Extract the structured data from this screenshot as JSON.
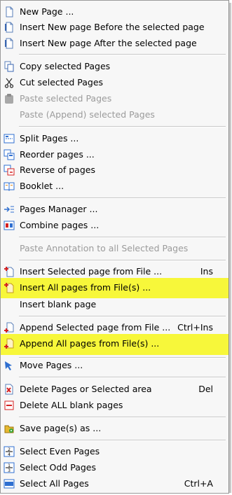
{
  "menu": {
    "items": [
      {
        "label": "New Page ...",
        "shortcut": "",
        "icon": "new-page-icon",
        "disabled": false,
        "highlighted": false
      },
      {
        "label": "Insert New page Before the selected page",
        "shortcut": "",
        "icon": "page-icon",
        "disabled": false,
        "highlighted": false
      },
      {
        "label": "Insert New page After the selected page",
        "shortcut": "",
        "icon": "page-icon",
        "disabled": false,
        "highlighted": false
      },
      {
        "label": "Copy selected Pages",
        "shortcut": "",
        "icon": "copy-icon",
        "disabled": false,
        "highlighted": false
      },
      {
        "label": "Cut selected Pages",
        "shortcut": "",
        "icon": "scissors-icon",
        "disabled": false,
        "highlighted": false
      },
      {
        "label": "Paste selected Pages",
        "shortcut": "",
        "icon": "paste-icon",
        "disabled": true,
        "highlighted": false
      },
      {
        "label": "Paste (Append) selected Pages",
        "shortcut": "",
        "icon": "",
        "disabled": true,
        "highlighted": false
      },
      {
        "label": "Split Pages ...",
        "shortcut": "",
        "icon": "split-pages-icon",
        "disabled": false,
        "highlighted": false
      },
      {
        "label": "Reorder pages ...",
        "shortcut": "",
        "icon": "reorder-pages-icon",
        "disabled": false,
        "highlighted": false
      },
      {
        "label": "Reverse of pages",
        "shortcut": "",
        "icon": "reverse-pages-icon",
        "disabled": false,
        "highlighted": false
      },
      {
        "label": "Booklet ...",
        "shortcut": "",
        "icon": "booklet-icon",
        "disabled": false,
        "highlighted": false
      },
      {
        "label": "Pages Manager ...",
        "shortcut": "",
        "icon": "pages-manager-icon",
        "disabled": false,
        "highlighted": false
      },
      {
        "label": "Combine pages ...",
        "shortcut": "",
        "icon": "combine-pages-icon",
        "disabled": false,
        "highlighted": false
      },
      {
        "label": "Paste Annotation to all Selected Pages",
        "shortcut": "",
        "icon": "",
        "disabled": true,
        "highlighted": false
      },
      {
        "label": "Insert Selected page from File ...",
        "shortcut": "Ins",
        "icon": "insert-page-icon",
        "disabled": false,
        "highlighted": false
      },
      {
        "label": "Insert All pages from File(s) ...",
        "shortcut": "",
        "icon": "insert-all-pages-icon",
        "disabled": false,
        "highlighted": true
      },
      {
        "label": "Insert blank page",
        "shortcut": "",
        "icon": "",
        "disabled": false,
        "highlighted": false
      },
      {
        "label": "Append Selected page from File ...",
        "shortcut": "Ctrl+Ins",
        "icon": "append-page-icon",
        "disabled": false,
        "highlighted": false
      },
      {
        "label": "Append All pages from File(s) ...",
        "shortcut": "",
        "icon": "append-all-pages-icon",
        "disabled": false,
        "highlighted": true
      },
      {
        "label": "Move Pages ...",
        "shortcut": "",
        "icon": "move-pages-icon",
        "disabled": false,
        "highlighted": false
      },
      {
        "label": "Delete Pages or Selected area",
        "shortcut": "Del",
        "icon": "delete-pages-icon",
        "disabled": false,
        "highlighted": false
      },
      {
        "label": "Delete ALL blank pages",
        "shortcut": "",
        "icon": "delete-blank-pages-icon",
        "disabled": false,
        "highlighted": false
      },
      {
        "label": "Save page(s) as ...",
        "shortcut": "",
        "icon": "save-pages-icon",
        "disabled": false,
        "highlighted": false
      },
      {
        "label": "Select Even Pages",
        "shortcut": "",
        "icon": "select-even-icon",
        "disabled": false,
        "highlighted": false
      },
      {
        "label": "Select Odd Pages",
        "shortcut": "",
        "icon": "select-odd-icon",
        "disabled": false,
        "highlighted": false
      },
      {
        "label": "Select All Pages",
        "shortcut": "Ctrl+A",
        "icon": "select-all-icon",
        "disabled": false,
        "highlighted": false
      }
    ]
  },
  "colors": {
    "menu_background": "#f7f7f7",
    "highlight": "#f7f73a",
    "disabled_text": "#9b9b9b",
    "accent_blue": "#2f6fd0",
    "accent_red": "#d42020"
  }
}
